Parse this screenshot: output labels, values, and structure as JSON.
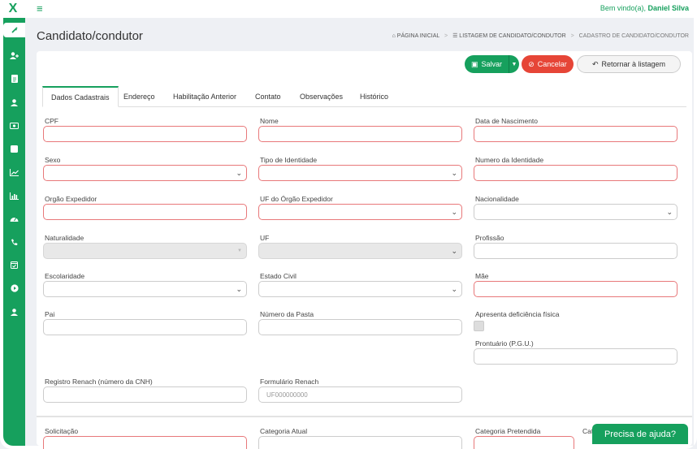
{
  "header": {
    "welcome_prefix": "Bem vindo(a),",
    "user_name": "Daniel Silva",
    "logo_text": "X"
  },
  "sidebar": {
    "items": [
      {
        "icon": "wrench-icon",
        "active": true
      },
      {
        "icon": "user-plus-icon"
      },
      {
        "icon": "document-icon"
      },
      {
        "icon": "user-icon"
      },
      {
        "icon": "money-icon"
      },
      {
        "icon": "book-icon"
      },
      {
        "icon": "line-chart-icon"
      },
      {
        "icon": "bar-chart-icon"
      },
      {
        "icon": "dashboard-icon"
      },
      {
        "icon": "phone-icon"
      },
      {
        "icon": "calendar-check-icon"
      },
      {
        "icon": "play-circle-icon"
      },
      {
        "icon": "user-icon"
      }
    ]
  },
  "page": {
    "title": "Candidato/condutor",
    "breadcrumb": [
      "PÁGINA INICIAL",
      "LISTAGEM DE CANDIDATO/CONDUTOR",
      "CADASTRO DE CANDIDATO/CONDUTOR"
    ]
  },
  "toolbar": {
    "save_label": "Salvar",
    "cancel_label": "Cancelar",
    "back_label": "Retornar à listagem"
  },
  "tabs": [
    "Dados Cadastrais",
    "Endereço",
    "Habilitação Anterior",
    "Contato",
    "Observações",
    "Histórico"
  ],
  "form": {
    "cpf": {
      "label": "CPF",
      "value": ""
    },
    "nome": {
      "label": "Nome",
      "value": ""
    },
    "data_nascimento": {
      "label": "Data de Nascimento",
      "value": ""
    },
    "sexo": {
      "label": "Sexo",
      "value": ""
    },
    "tipo_identidade": {
      "label": "Tipo de Identidade",
      "value": ""
    },
    "numero_identidade": {
      "label": "Numero da Identidade",
      "value": ""
    },
    "orgao_expedidor": {
      "label": "Orgão Expedidor",
      "value": ""
    },
    "uf_orgao": {
      "label": "UF do Órgão Expedidor",
      "value": ""
    },
    "nacionalidade": {
      "label": "Nacionalidade",
      "value": ""
    },
    "naturalidade": {
      "label": "Naturalidade",
      "value": ""
    },
    "uf": {
      "label": "UF",
      "value": ""
    },
    "profissao": {
      "label": "Profissão",
      "value": ""
    },
    "escolaridade": {
      "label": "Escolaridade",
      "value": ""
    },
    "estado_civil": {
      "label": "Estado Civil",
      "value": ""
    },
    "mae": {
      "label": "Mãe",
      "value": ""
    },
    "pai": {
      "label": "Pai",
      "value": ""
    },
    "numero_pasta": {
      "label": "Número da Pasta",
      "value": ""
    },
    "deficiencia": {
      "label": "Apresenta deficiência física",
      "checked": false
    },
    "prontuario": {
      "label": "Prontuário (P.G.U.)",
      "value": ""
    },
    "renach": {
      "label": "Registro Renach (número da CNH)",
      "value": ""
    },
    "formulario_renach": {
      "label": "Formulário Renach",
      "placeholder": "UF000000000"
    },
    "solicitacao": {
      "label": "Solicitação"
    },
    "categoria_atual": {
      "label": "Categoria Atual"
    },
    "categoria_pretendida": {
      "label": "Categoria Pretendida"
    },
    "cat_truncated": {
      "label": "Cat"
    }
  },
  "help": {
    "label": "Precisa de ajuda?"
  },
  "colors": {
    "brand": "#16a05d",
    "danger": "#e64537",
    "required_border": "#e8787a"
  }
}
